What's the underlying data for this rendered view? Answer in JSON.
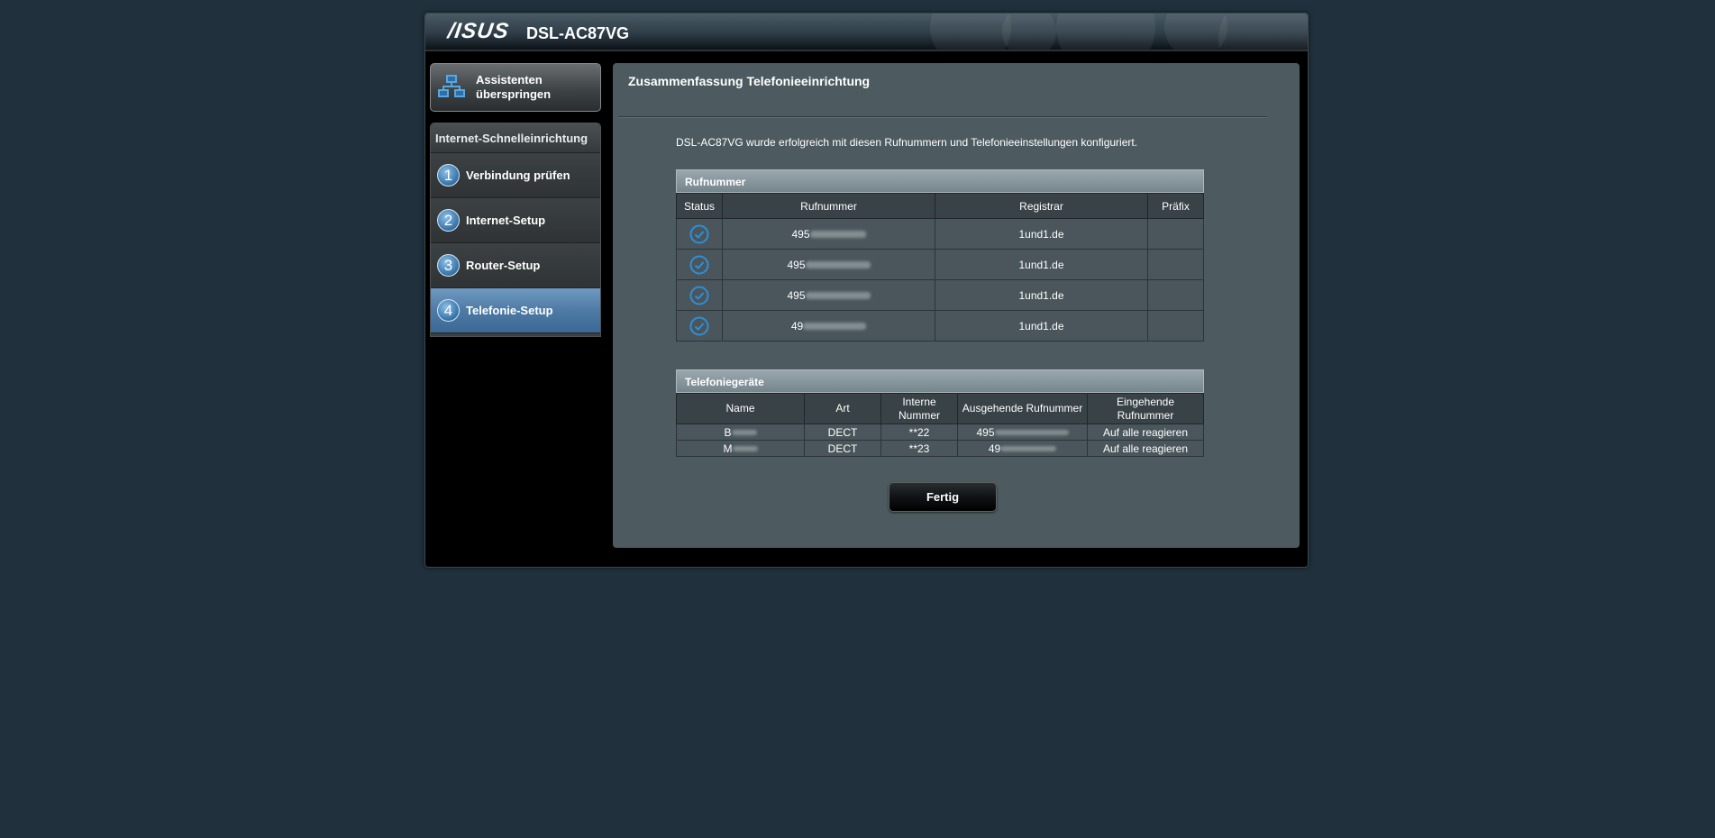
{
  "header": {
    "brand": "/ISUS",
    "model": "DSL-AC87VG"
  },
  "sidebar": {
    "skip_label": "Assistenten überspringen",
    "steps_title": "Internet-Schnelleinrichtung",
    "steps": [
      {
        "num": "1",
        "label": "Verbindung prüfen"
      },
      {
        "num": "2",
        "label": "Internet-Setup"
      },
      {
        "num": "3",
        "label": "Router-Setup"
      },
      {
        "num": "4",
        "label": "Telefonie-Setup"
      }
    ]
  },
  "main": {
    "title": "Zusammenfassung Telefonieeinrichtung",
    "description": "DSL-AC87VG wurde erfolgreich mit diesen Rufnummern und Telefonieeinstellungen konfiguriert.",
    "numbers_table": {
      "title": "Rufnummer",
      "headers": [
        "Status",
        "Rufnummer",
        "Registrar",
        "Präfix"
      ],
      "rows": [
        {
          "status": "check-icon",
          "number": "495",
          "registrar": "1und1.de",
          "prefix": ""
        },
        {
          "status": "check-icon",
          "number": "495",
          "registrar": "1und1.de",
          "prefix": ""
        },
        {
          "status": "check-icon",
          "number": "495",
          "registrar": "1und1.de",
          "prefix": ""
        },
        {
          "status": "check-icon",
          "number": "49",
          "registrar": "1und1.de",
          "prefix": ""
        }
      ]
    },
    "devices_table": {
      "title": "Telefoniegeräte",
      "headers": [
        "Name",
        "Art",
        "Interne Nummer",
        "Ausgehende Rufnummer",
        "Eingehende Rufnummer"
      ],
      "rows": [
        {
          "name": "B",
          "type": "DECT",
          "internal": "**22",
          "outgoing": "495",
          "incoming": "Auf alle reagieren"
        },
        {
          "name": "M",
          "type": "DECT",
          "internal": "**23",
          "outgoing": "49",
          "incoming": "Auf alle reagieren"
        }
      ]
    },
    "finish_label": "Fertig"
  },
  "colors": {
    "page_bg": "#20313d",
    "content_bg": "#4d5a5f",
    "active_step": "#4e7aa5",
    "check": "#2f8fd8"
  }
}
